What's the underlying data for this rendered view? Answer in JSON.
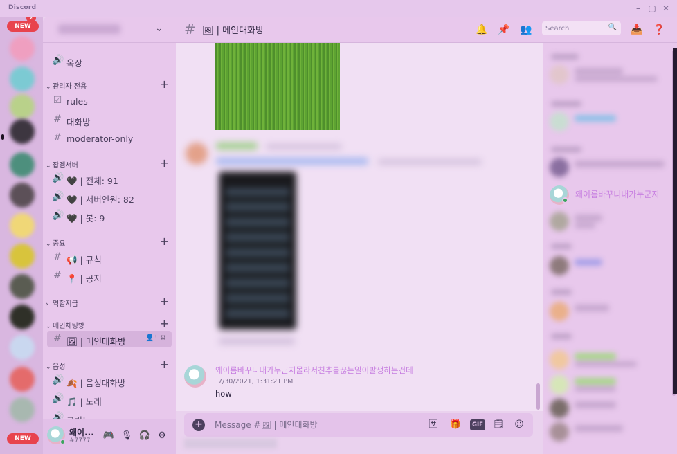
{
  "window": {
    "brand": "Discord",
    "controls": [
      "minimize",
      "maximize",
      "close"
    ]
  },
  "rail": {
    "new_badge": "NEW",
    "top_mention": "2",
    "bottom_new_badge": "NEW"
  },
  "sidebar": {
    "server_chevron": "⌄",
    "channels": [
      {
        "type": "voice",
        "label": "옥상"
      },
      {
        "type": "category",
        "label": "관리자 전용"
      },
      {
        "type": "rules",
        "label": "rules"
      },
      {
        "type": "text",
        "label": "대화방"
      },
      {
        "type": "text",
        "label": "moderator-only"
      },
      {
        "type": "category",
        "label": "잡겜서버"
      },
      {
        "type": "voice",
        "label": "🖤 | 전체: 91"
      },
      {
        "type": "voice",
        "label": "🖤 | 서버인원: 82"
      },
      {
        "type": "voice",
        "label": "🖤 | 봇: 9"
      },
      {
        "type": "category",
        "label": "중요"
      },
      {
        "type": "text",
        "label": "📢 | 규칙"
      },
      {
        "type": "text",
        "label": "📍 | 공지"
      },
      {
        "type": "category",
        "label": "역할지급"
      },
      {
        "type": "category",
        "label": "메인채팅방"
      },
      {
        "type": "text",
        "label": "🖼 | 메인대화방",
        "active": true
      },
      {
        "type": "category",
        "label": "음성"
      },
      {
        "type": "voice",
        "label": "🍂 | 음성대화방"
      },
      {
        "type": "voice",
        "label": "🎵 | 노래"
      },
      {
        "type": "voice",
        "label": "그림!"
      }
    ]
  },
  "user": {
    "name": "왜이...",
    "tag": "#7777"
  },
  "topbar": {
    "channel_name": "🖼 | 메인대화방",
    "search_placeholder": "Search"
  },
  "message": {
    "author": "왜이름바꾸니내가누군지몰라서친추를끊는일이발생하는건데",
    "timestamp": "7/30/2021, 1:31:21 PM",
    "text": "how"
  },
  "composer": {
    "placeholder": "Message #🖼 | 메인대화방",
    "gif_label": "GIF"
  },
  "members": {
    "visible_name": "왜이름바꾸니내가누군지"
  },
  "colors": {
    "accent_name": "#c77ee0",
    "online": "#3ba55d",
    "badge": "#e8434d"
  }
}
